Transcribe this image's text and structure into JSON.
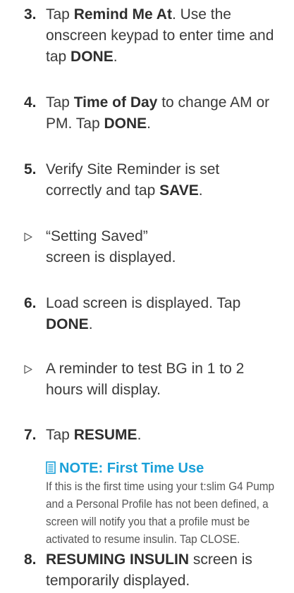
{
  "steps": [
    {
      "num": "3.",
      "parts": [
        "Tap ",
        "Remind Me At",
        ". Use the onscreen keypad to enter time and tap ",
        "DONE",
        "."
      ]
    },
    {
      "num": "4.",
      "parts": [
        "Tap ",
        "Time of Day",
        " to change AM or PM. Tap ",
        "DONE",
        "."
      ]
    },
    {
      "num": "5.",
      "parts": [
        "Verify Site Reminder is set correctly and tap ",
        "SAVE",
        "."
      ]
    },
    {
      "num": "6.",
      "parts": [
        "Load screen is displayed. Tap ",
        "DONE",
        "."
      ]
    },
    {
      "num": "7.",
      "parts": [
        "Tap ",
        "RESUME",
        "."
      ]
    },
    {
      "num": "8.",
      "parts": [
        "RESUMING INSULIN",
        " screen is temporarily displayed."
      ]
    }
  ],
  "results": [
    {
      "text": "“Setting Saved” screen is displayed."
    },
    {
      "text": "A reminder to test BG in 1 to 2 hours will display."
    }
  ],
  "note": {
    "title": "NOTE: First Time Use",
    "body": "If this is the first time using your t:slim G4 Pump and a Personal Profile has not been defined, a screen will notify you that a profile must be activated to resume insulin. Tap CLOSE."
  },
  "colors": {
    "accent": "#1aa0d8",
    "text": "#3a3a3a"
  },
  "icons": {
    "result": "triangle-right-outline-icon",
    "note": "note-document-icon"
  }
}
